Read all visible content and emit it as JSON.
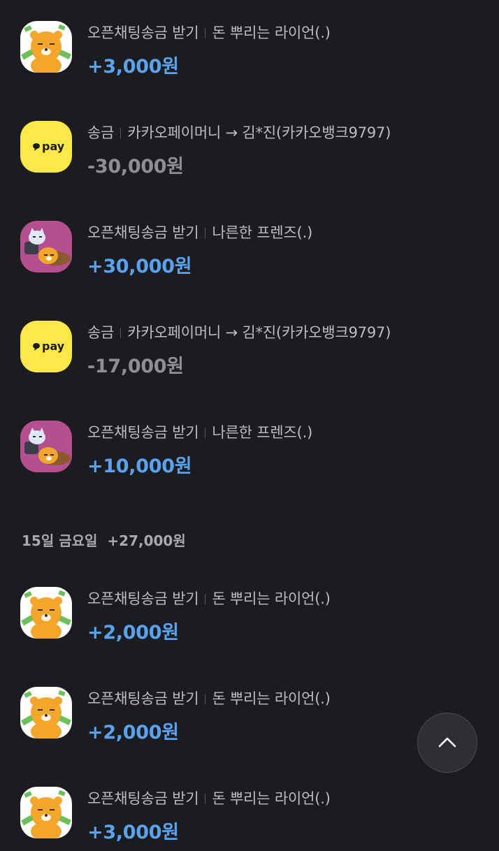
{
  "transactions_top": [
    {
      "kind": "lion-icon",
      "type": "오픈채팅송금 받기",
      "counterparty": "돈 뿌리는 라이언(.)",
      "amount": "+3,000원",
      "direction": "in"
    },
    {
      "kind": "kakaopay-icon",
      "type": "송금",
      "counterparty": "카카오페이머니 → 김*진(카카오뱅크9797)",
      "amount": "-30,000원",
      "direction": "out"
    },
    {
      "kind": "friends-icon",
      "type": "오픈채팅송금 받기",
      "counterparty": "나른한 프렌즈(.)",
      "amount": "+30,000원",
      "direction": "in"
    },
    {
      "kind": "kakaopay-icon",
      "type": "송금",
      "counterparty": "카카오페이머니 → 김*진(카카오뱅크9797)",
      "amount": "-17,000원",
      "direction": "out"
    },
    {
      "kind": "friends-icon",
      "type": "오픈채팅송금 받기",
      "counterparty": "나른한 프렌즈(.)",
      "amount": "+10,000원",
      "direction": "in"
    }
  ],
  "day_group": {
    "label": "15일 금요일",
    "total": "+27,000원"
  },
  "transactions_bottom": [
    {
      "kind": "lion-icon",
      "type": "오픈채팅송금 받기",
      "counterparty": "돈 뿌리는 라이언(.)",
      "amount": "+2,000원",
      "direction": "in"
    },
    {
      "kind": "lion-icon",
      "type": "오픈채팅송금 받기",
      "counterparty": "돈 뿌리는 라이언(.)",
      "amount": "+2,000원",
      "direction": "in"
    },
    {
      "kind": "lion-icon",
      "type": "오픈채팅송금 받기",
      "counterparty": "돈 뿌리는 라이언(.)",
      "amount": "+3,000원",
      "direction": "in"
    }
  ],
  "pay_icon_text": "pay",
  "scroll_top_icon": "chevron-up-icon",
  "colors": {
    "background": "#1b1c20",
    "income": "#5aa2f0",
    "expense": "#8e8f94",
    "kakao_yellow": "#fde84a",
    "friends_pink": "#b54f8f"
  }
}
